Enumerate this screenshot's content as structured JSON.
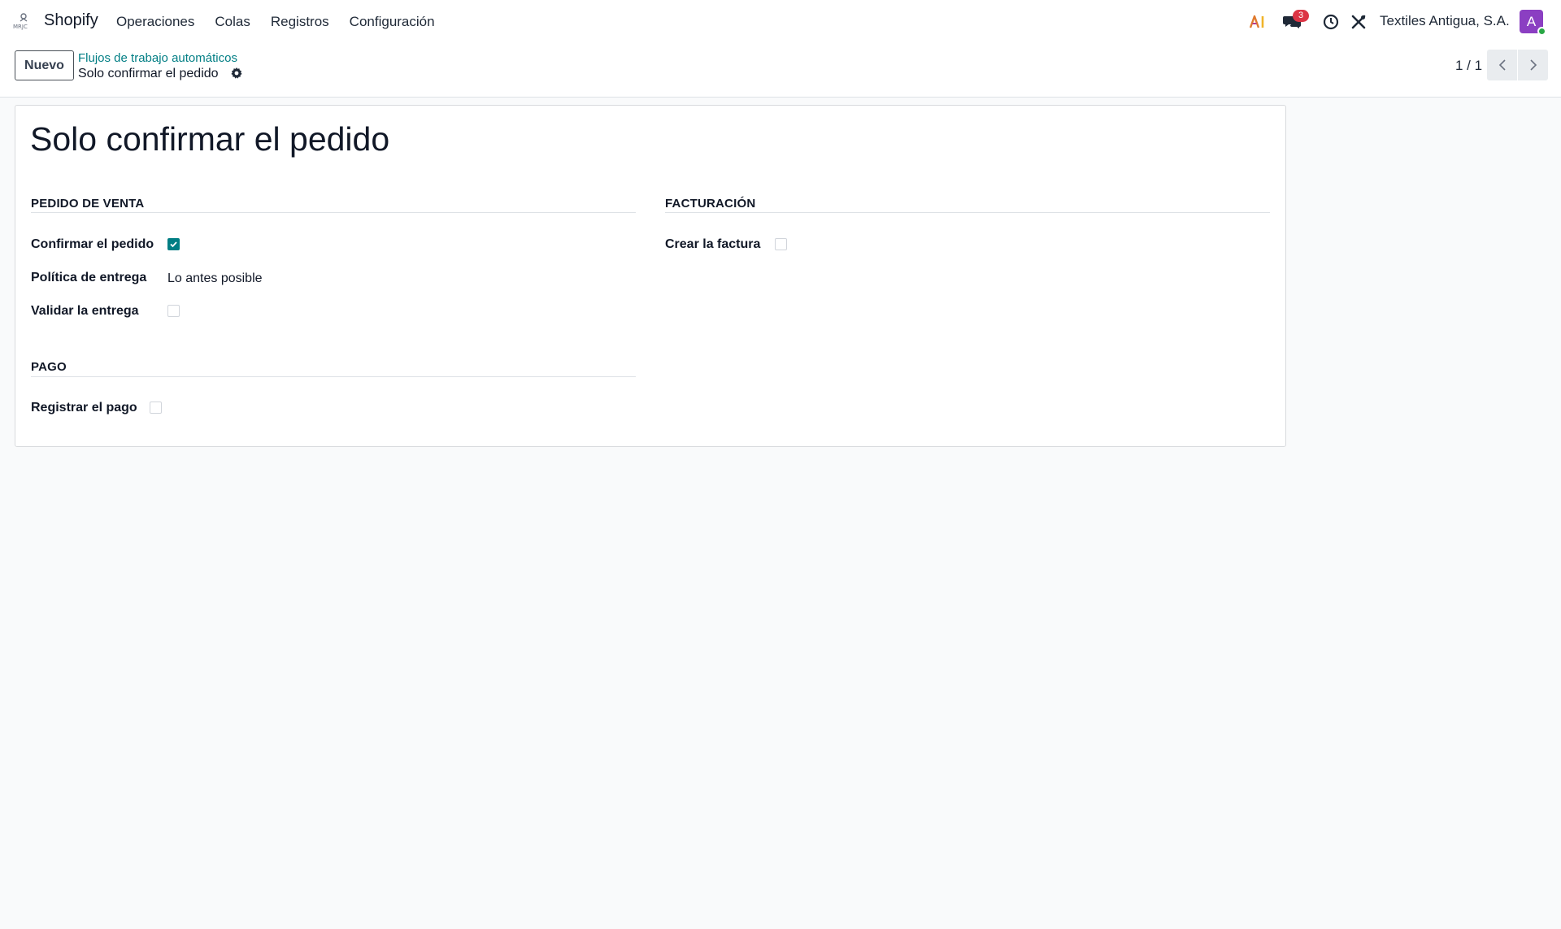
{
  "navbar": {
    "app_name": "Shopify",
    "menu": [
      "Operaciones",
      "Colas",
      "Registros",
      "Configuración"
    ],
    "messages_count": "3",
    "company": "Textiles Antigua, S.A.",
    "avatar_initial": "A"
  },
  "control": {
    "new_label": "Nuevo",
    "breadcrumb_parent": "Flujos de trabajo automáticos",
    "breadcrumb_current": "Solo confirmar el pedido",
    "pager": "1 / 1"
  },
  "form": {
    "title": "Solo confirmar el pedido",
    "sales_order": {
      "heading": "PEDIDO DE VENTA",
      "confirm_order": {
        "label": "Confirmar el pedido",
        "checked": true
      },
      "delivery_policy": {
        "label": "Política de entrega",
        "value": "Lo antes posible"
      },
      "validate_delivery": {
        "label": "Validar la entrega",
        "checked": false
      }
    },
    "invoicing": {
      "heading": "FACTURACIÓN",
      "create_invoice": {
        "label": "Crear la factura",
        "checked": false
      }
    },
    "payment": {
      "heading": "PAGO",
      "register_payment": {
        "label": "Registrar el pago",
        "checked": false
      }
    }
  },
  "colors": {
    "accent": "#017e84",
    "badge": "#dc3545",
    "avatar": "#8b3fc2"
  }
}
